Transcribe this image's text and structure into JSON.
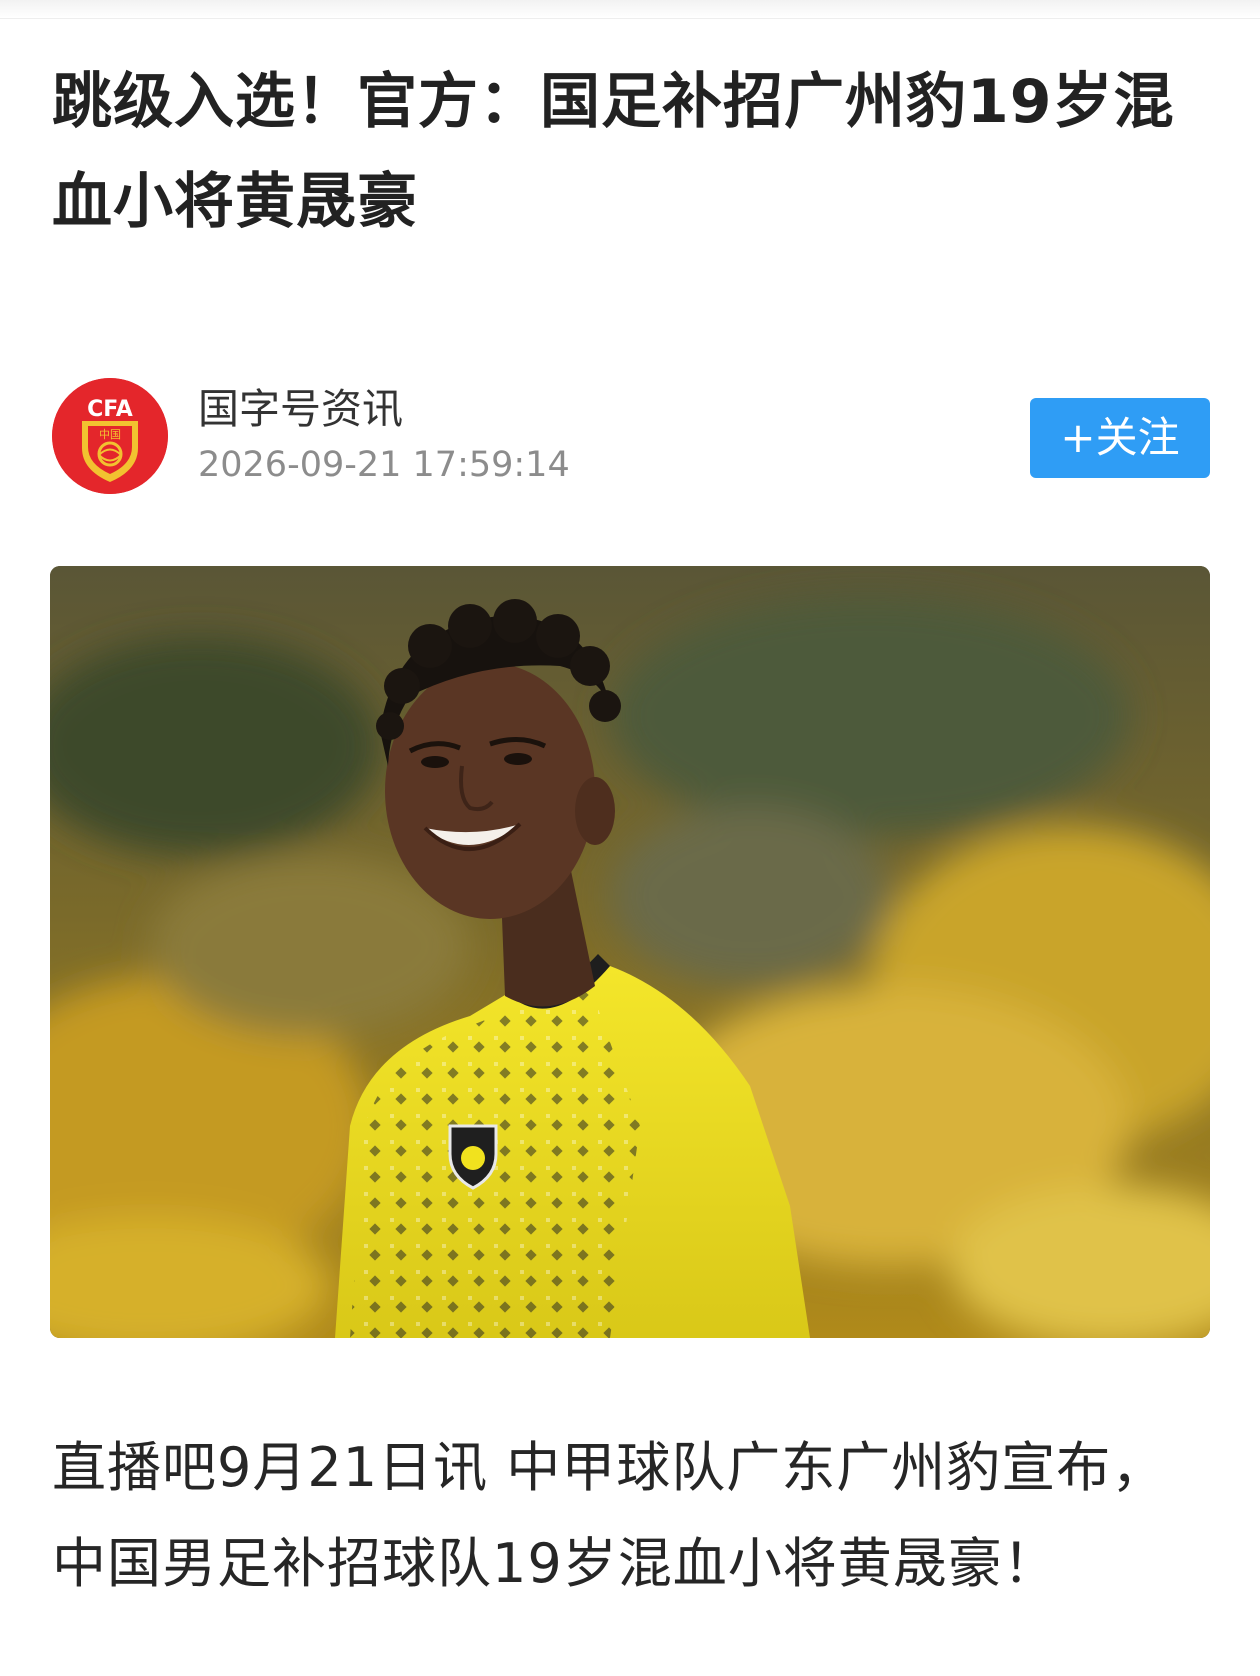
{
  "article": {
    "title": "跳级入选！官方：国足补招广州豹19岁混血小将黄晟豪",
    "body": "直播吧9月21日讯 中甲球队广东广州豹宣布，中国男足补招球队19岁混血小将黄晟豪！"
  },
  "author": {
    "name": "国字号资讯",
    "publish_time": "2026-09-21 17:59:14",
    "avatar_logo_text": "CFA",
    "avatar_logo_subtext": "中国",
    "follow_label": "+关注"
  },
  "colors": {
    "accent_blue": "#2f9df5",
    "avatar_red": "#e4262b",
    "logo_gold": "#f2c230",
    "jersey_yellow": "#f1e21e"
  },
  "icons": {
    "avatar": "cfa-logo-icon"
  }
}
